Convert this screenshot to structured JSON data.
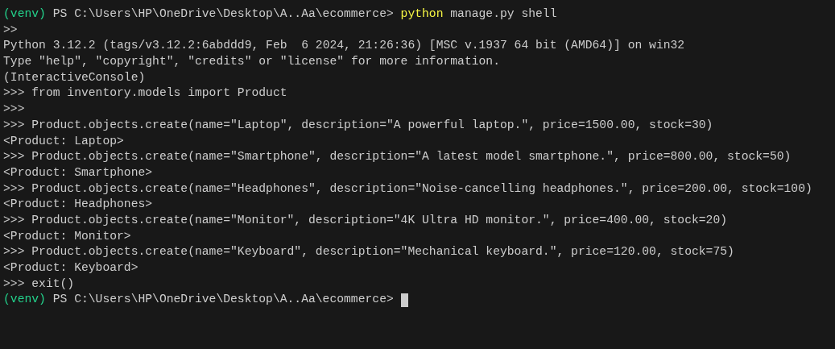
{
  "terminal": {
    "lines": [
      {
        "kind": "prompt",
        "env": "(venv)",
        "path": "PS C:\\Users\\HP\\OneDrive\\Desktop\\A..Aa\\ecommerce>",
        "command": "python",
        "args": "manage.py shell",
        "cursor": false
      },
      {
        "kind": "output",
        "text": ">>"
      },
      {
        "kind": "output",
        "text": "Python 3.12.2 (tags/v3.12.2:6abddd9, Feb  6 2024, 21:26:36) [MSC v.1937 64 bit (AMD64)] on win32"
      },
      {
        "kind": "output",
        "text": "Type \"help\", \"copyright\", \"credits\" or \"license\" for more information."
      },
      {
        "kind": "output",
        "text": "(InteractiveConsole)"
      },
      {
        "kind": "output",
        "text": ">>> from inventory.models import Product"
      },
      {
        "kind": "output",
        "text": ">>>"
      },
      {
        "kind": "output",
        "text": ">>> Product.objects.create(name=\"Laptop\", description=\"A powerful laptop.\", price=1500.00, stock=30)"
      },
      {
        "kind": "output",
        "text": "<Product: Laptop>"
      },
      {
        "kind": "output",
        "text": ">>> Product.objects.create(name=\"Smartphone\", description=\"A latest model smartphone.\", price=800.00, stock=50)"
      },
      {
        "kind": "output",
        "text": "<Product: Smartphone>"
      },
      {
        "kind": "output",
        "text": ">>> Product.objects.create(name=\"Headphones\", description=\"Noise-cancelling headphones.\", price=200.00, stock=100)"
      },
      {
        "kind": "output",
        "text": "<Product: Headphones>"
      },
      {
        "kind": "output",
        "text": ">>> Product.objects.create(name=\"Monitor\", description=\"4K Ultra HD monitor.\", price=400.00, stock=20)"
      },
      {
        "kind": "output",
        "text": "<Product: Monitor>"
      },
      {
        "kind": "output",
        "text": ">>> Product.objects.create(name=\"Keyboard\", description=\"Mechanical keyboard.\", price=120.00, stock=75)"
      },
      {
        "kind": "output",
        "text": "<Product: Keyboard>"
      },
      {
        "kind": "output",
        "text": ">>> exit()"
      },
      {
        "kind": "prompt",
        "env": "(venv)",
        "path": "PS C:\\Users\\HP\\OneDrive\\Desktop\\A..Aa\\ecommerce>",
        "cursor": true
      }
    ]
  }
}
